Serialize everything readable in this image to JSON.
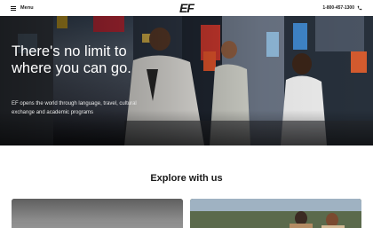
{
  "header": {
    "menu_label": "Menu",
    "menu_icon": "hamburger-icon",
    "logo_text": "EF",
    "phone_number": "1-800-457-1300",
    "phone_icon": "phone-icon"
  },
  "hero": {
    "title": "There's no limit to where you can go.",
    "subtitle": "EF opens the world through language, travel, cultural exchange and academic programs"
  },
  "explore": {
    "title": "Explore with us"
  },
  "colors": {
    "text": "#191919",
    "background": "#ffffff",
    "hero_text": "#ffffff"
  }
}
